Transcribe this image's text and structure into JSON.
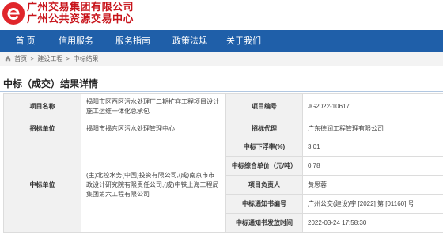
{
  "header": {
    "logo_icon": "gzgroup-e-logo-icon",
    "brand_line1": "广州交易集团有限公司",
    "brand_line2": "广州公共资源交易中心",
    "brand_color": "#c8141b"
  },
  "nav": {
    "background": "#1f5fa9",
    "items": [
      "首 页",
      "信用服务",
      "服务指南",
      "政策法规",
      "关于我们"
    ]
  },
  "breadcrumb": {
    "home_icon": "home-icon",
    "items": [
      "首页",
      "建设工程",
      "中标结果"
    ],
    "separator": ">"
  },
  "page_title": "中标（成交）结果详情",
  "details": {
    "project_name_label": "项目名称",
    "project_name": "揭阳市区西区污水处理厂二期扩容工程项目设计施工运维一体化总承包",
    "project_code_label": "项目编号",
    "project_code": "JG2022-10617",
    "tenderer_label": "招标单位",
    "tenderer": "揭阳市揭东区污水处理管理中心",
    "agent_label": "招标代理",
    "agent": "广东德润工程管理有限公司",
    "winner_label": "中标单位",
    "winner": "(主)北控水务(中国)投资有限公司,(成)南京市市政设计研究院有限责任公司,(成)中铁上海工程局集团第六工程有限公司",
    "down_rate_label": "中标下浮率(%)",
    "down_rate": "3.01",
    "unit_price_label": "中标综合单价（元/吨）",
    "unit_price": "0.78",
    "pm_label": "项目负责人",
    "pm": "黄思蓉",
    "notice_no_label": "中标通知书编号",
    "notice_no": "广州公交(建设)字 [2022] 第 [01160] 号",
    "notice_date_label": "中标通知书发放时间",
    "notice_date": "2022-03-24 17:58:30"
  }
}
